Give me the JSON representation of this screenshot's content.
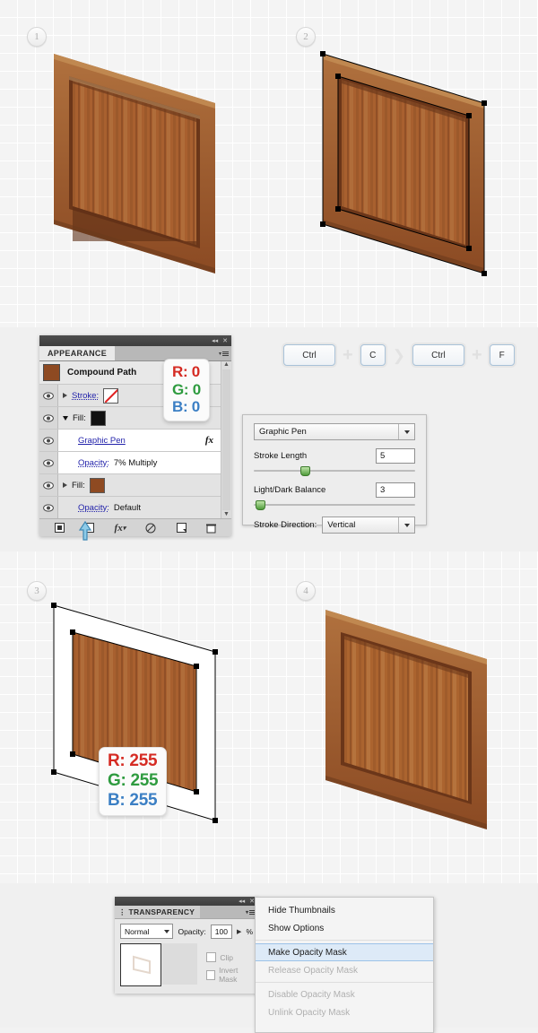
{
  "steps": [
    {
      "number": "1"
    },
    {
      "number": "2"
    },
    {
      "number": "3"
    },
    {
      "number": "4"
    }
  ],
  "tooltips": {
    "black": {
      "r": "R: 0",
      "g": "G: 0",
      "b": "B: 0"
    },
    "white": {
      "r": "R: 255",
      "g": "G: 255",
      "b": "B: 255"
    }
  },
  "appearance_panel": {
    "tab_label": "APPEARANCE",
    "collapse_icon": "collapse-icon",
    "close_icon": "close-icon",
    "menu_icon": "panel-menu-icon",
    "object_title": "Compound Path",
    "rows": [
      {
        "label": "Stroke:",
        "value": "",
        "swatch": "none"
      },
      {
        "label": "Fill:",
        "value": "",
        "swatch": "black"
      },
      {
        "label": "Graphic Pen",
        "value": "",
        "fx": "fx"
      },
      {
        "label": "Opacity:",
        "value": "7% Multiply"
      },
      {
        "label": "Fill:",
        "value": "",
        "swatch": "brown"
      },
      {
        "label": "Opacity:",
        "value": "Default"
      }
    ],
    "footer_icons": [
      "add-new-stroke-icon",
      "add-new-fill-icon",
      "add-effect-icon",
      "clear-appearance-icon",
      "duplicate-item-icon",
      "delete-item-icon"
    ]
  },
  "shortcut": {
    "keys": [
      "Ctrl",
      "C",
      "Ctrl",
      "F"
    ],
    "plus": "+",
    "separator": "❯"
  },
  "graphic_pen_dialog": {
    "effect_name": "Graphic Pen",
    "stroke_length": {
      "label": "Stroke Length",
      "value": "5"
    },
    "light_dark_balance": {
      "label": "Light/Dark Balance",
      "value": "3"
    },
    "stroke_direction": {
      "label": "Stroke Direction:",
      "value": "Vertical"
    }
  },
  "transparency_panel": {
    "tab_label": "TRANSPARENCY",
    "blend_mode": "Normal",
    "opacity_label": "Opacity:",
    "opacity_value": "100",
    "percent": "%",
    "clip_label": "Clip",
    "invert_label": "Invert Mask"
  },
  "context_menu": {
    "items": [
      {
        "label": "Hide Thumbnails",
        "state": "normal"
      },
      {
        "label": "Show Options",
        "state": "normal"
      },
      {
        "label": "Make Opacity Mask",
        "state": "selected"
      },
      {
        "label": "Release Opacity Mask",
        "state": "disabled"
      },
      {
        "label": "Disable Opacity Mask",
        "state": "disabled"
      },
      {
        "label": "Unlink Opacity Mask",
        "state": "disabled"
      }
    ]
  },
  "colors": {
    "wood_light": "#b3713c",
    "wood_mid": "#a0602f",
    "wood_dark": "#7e4321",
    "wood_darkest": "#6b3619",
    "white_shape": "#ffffff",
    "accent_red": "#d52b23",
    "accent_green": "#2e9b3f",
    "accent_blue": "#3b7fc4",
    "selection_blue": "#ddeaf7"
  }
}
